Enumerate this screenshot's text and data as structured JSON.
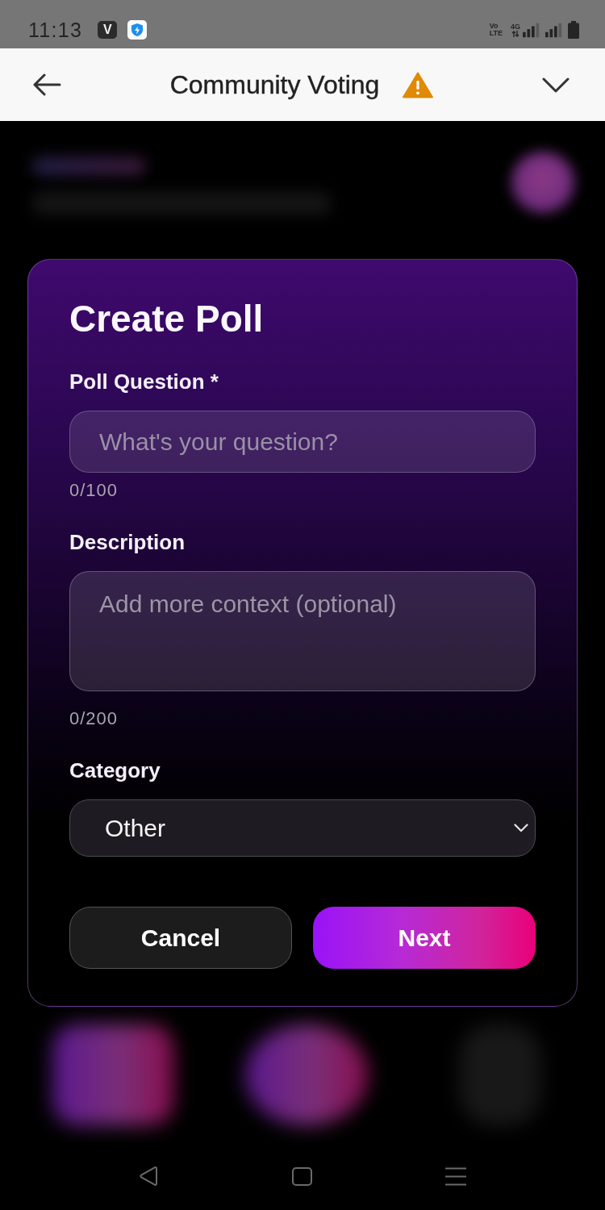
{
  "status_bar": {
    "time": "11:13",
    "notification_icons": [
      {
        "kind": "letter",
        "text": "V"
      },
      {
        "kind": "shield"
      }
    ],
    "volte": {
      "top": "Vo",
      "bottom": "LTE"
    },
    "network_type": "4G"
  },
  "app_bar": {
    "title": "Community Voting"
  },
  "dialog": {
    "title": "Create Poll",
    "fields": [
      {
        "kind": "input",
        "label": "Poll Question *",
        "placeholder": "What's your question?",
        "counter": "0/100"
      },
      {
        "kind": "textarea",
        "label": "Description",
        "placeholder": "Add more context (optional)",
        "counter": "0/200"
      },
      {
        "kind": "select",
        "label": "Category",
        "value": "Other"
      }
    ],
    "buttons": [
      {
        "kind": "secondary",
        "label": "Cancel"
      },
      {
        "kind": "primary",
        "label": "Next"
      }
    ]
  }
}
